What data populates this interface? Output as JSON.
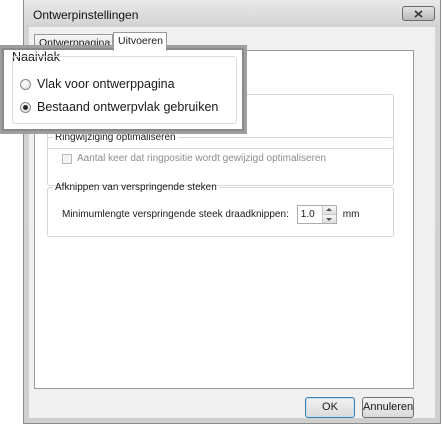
{
  "window": {
    "title": "Ontwerpinstellingen"
  },
  "tabs": [
    {
      "label": "Ontwerppagina"
    },
    {
      "label": "Uitvoeren"
    }
  ],
  "hoop_change": {
    "legend": "Ringwijziging optimaliseren",
    "checkbox_label": "Aantal keer dat ringpositie wordt gewijzigd optimaliseren",
    "checked": false
  },
  "trim": {
    "legend": "Afknippen van verspringende steken",
    "field_label": "Minimumlengte verspringende steek draadknippen:",
    "value": "1.0",
    "unit": "mm"
  },
  "buttons": {
    "ok": "OK",
    "cancel": "Annuleren"
  },
  "zoom": {
    "legend": "Naaivlak",
    "options": [
      {
        "label": "Vlak voor ontwerppagina",
        "checked": false
      },
      {
        "label": "Bestaand ontwerpvlak gebruiken",
        "checked": true
      }
    ]
  }
}
